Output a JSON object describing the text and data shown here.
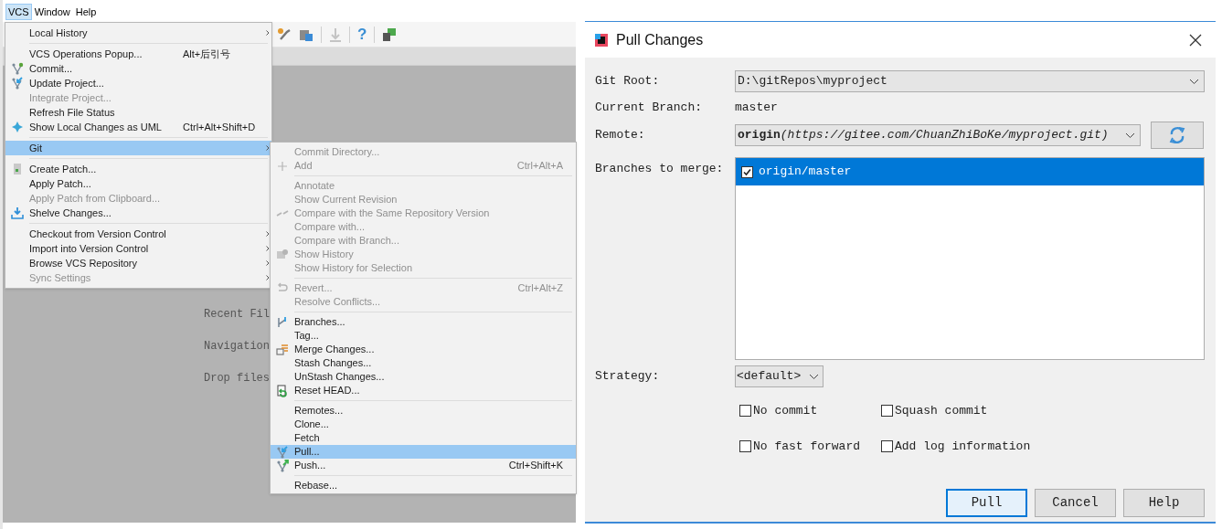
{
  "menu_bar": [
    {
      "label": "VCS",
      "selected": true
    },
    {
      "label": "Window",
      "selected": false
    },
    {
      "label": "Help",
      "selected": false
    }
  ],
  "toolbar": {
    "help_glyph": "?"
  },
  "welcome": [
    "Recent Fil",
    "Navigation",
    "Drop files"
  ],
  "vcs_menu": {
    "items": [
      {
        "kind": "item",
        "label": "Local History",
        "submenu": true,
        "disabled": false,
        "selected": false
      },
      {
        "kind": "separator"
      },
      {
        "kind": "item",
        "label": "VCS Operations Popup...",
        "shortcut": "Alt+后引号",
        "submenu": false,
        "disabled": false,
        "selected": false
      },
      {
        "kind": "item",
        "label": "Commit...",
        "submenu": false,
        "disabled": false,
        "selected": false
      },
      {
        "kind": "item",
        "label": "Update Project...",
        "submenu": false,
        "disabled": false,
        "selected": false
      },
      {
        "kind": "item",
        "label": "Integrate Project...",
        "submenu": false,
        "disabled": true,
        "selected": false
      },
      {
        "kind": "item",
        "label": "Refresh File Status",
        "submenu": false,
        "disabled": false,
        "selected": false
      },
      {
        "kind": "item",
        "label": "Show Local Changes as UML",
        "shortcut": "Ctrl+Alt+Shift+D",
        "submenu": false,
        "disabled": false,
        "selected": false
      },
      {
        "kind": "separator"
      },
      {
        "kind": "item",
        "label": "Git",
        "submenu": true,
        "disabled": false,
        "selected": true
      },
      {
        "kind": "separator"
      },
      {
        "kind": "item",
        "label": "Create Patch...",
        "submenu": false,
        "disabled": false,
        "selected": false
      },
      {
        "kind": "item",
        "label": "Apply Patch...",
        "submenu": false,
        "disabled": false,
        "selected": false
      },
      {
        "kind": "item",
        "label": "Apply Patch from Clipboard...",
        "submenu": false,
        "disabled": true,
        "selected": false
      },
      {
        "kind": "item",
        "label": "Shelve Changes...",
        "submenu": false,
        "disabled": false,
        "selected": false
      },
      {
        "kind": "separator"
      },
      {
        "kind": "item",
        "label": "Checkout from Version Control",
        "submenu": true,
        "disabled": false,
        "selected": false
      },
      {
        "kind": "item",
        "label": "Import into Version Control",
        "submenu": true,
        "disabled": false,
        "selected": false
      },
      {
        "kind": "item",
        "label": "Browse VCS Repository",
        "submenu": true,
        "disabled": false,
        "selected": false
      },
      {
        "kind": "item",
        "label": "Sync Settings",
        "submenu": true,
        "disabled": true,
        "selected": false
      }
    ]
  },
  "git_menu": {
    "items": [
      {
        "kind": "item",
        "label": "Commit Directory...",
        "disabled": true,
        "selected": false
      },
      {
        "kind": "item",
        "label": "Add",
        "shortcut": "Ctrl+Alt+A",
        "disabled": true,
        "selected": false
      },
      {
        "kind": "separator"
      },
      {
        "kind": "item",
        "label": "Annotate",
        "disabled": true,
        "selected": false
      },
      {
        "kind": "item",
        "label": "Show Current Revision",
        "disabled": true,
        "selected": false
      },
      {
        "kind": "item",
        "label": "Compare with the Same Repository Version",
        "disabled": true,
        "selected": false
      },
      {
        "kind": "item",
        "label": "Compare with...",
        "disabled": true,
        "selected": false
      },
      {
        "kind": "item",
        "label": "Compare with Branch...",
        "disabled": true,
        "selected": false
      },
      {
        "kind": "item",
        "label": "Show History",
        "disabled": true,
        "selected": false
      },
      {
        "kind": "item",
        "label": "Show History for Selection",
        "disabled": true,
        "selected": false
      },
      {
        "kind": "separator"
      },
      {
        "kind": "item",
        "label": "Revert...",
        "shortcut": "Ctrl+Alt+Z",
        "disabled": true,
        "selected": false
      },
      {
        "kind": "item",
        "label": "Resolve Conflicts...",
        "disabled": true,
        "selected": false
      },
      {
        "kind": "separator"
      },
      {
        "kind": "item",
        "label": "Branches...",
        "disabled": false,
        "selected": false
      },
      {
        "kind": "item",
        "label": "Tag...",
        "disabled": false,
        "selected": false
      },
      {
        "kind": "item",
        "label": "Merge Changes...",
        "disabled": false,
        "selected": false
      },
      {
        "kind": "item",
        "label": "Stash Changes...",
        "disabled": false,
        "selected": false
      },
      {
        "kind": "item",
        "label": "UnStash Changes...",
        "disabled": false,
        "selected": false
      },
      {
        "kind": "item",
        "label": "Reset HEAD...",
        "disabled": false,
        "selected": false
      },
      {
        "kind": "separator"
      },
      {
        "kind": "item",
        "label": "Remotes...",
        "disabled": false,
        "selected": false
      },
      {
        "kind": "item",
        "label": "Clone...",
        "disabled": false,
        "selected": false
      },
      {
        "kind": "item",
        "label": "Fetch",
        "disabled": false,
        "selected": false
      },
      {
        "kind": "item",
        "label": "Pull...",
        "disabled": false,
        "selected": true
      },
      {
        "kind": "item",
        "label": "Push...",
        "shortcut": "Ctrl+Shift+K",
        "disabled": false,
        "selected": false
      },
      {
        "kind": "separator"
      },
      {
        "kind": "item",
        "label": "Rebase...",
        "disabled": false,
        "selected": false
      }
    ]
  },
  "dialog": {
    "title": "Pull Changes",
    "git_root": {
      "label": "Git Root:",
      "value": "D:\\gitRepos\\myproject"
    },
    "current_branch": {
      "label": "Current Branch:",
      "value": "master"
    },
    "remote": {
      "label": "Remote:",
      "name": "origin",
      "url": "(https://gitee.com/ChuanZhiBoKe/myproject.git)"
    },
    "branches": {
      "label": "Branches to merge:",
      "items": [
        {
          "label": "origin/master",
          "checked": true,
          "selected": true
        }
      ]
    },
    "strategy": {
      "label": "Strategy:",
      "value": "<default>"
    },
    "options": [
      {
        "label": "No commit",
        "checked": false
      },
      {
        "label": "Squash commit",
        "checked": false
      },
      {
        "label": "No fast forward",
        "checked": false
      },
      {
        "label": "Add log information",
        "checked": false
      }
    ],
    "buttons": [
      {
        "label": "Pull",
        "default": true
      },
      {
        "label": "Cancel",
        "default": false
      },
      {
        "label": "Help",
        "default": false
      }
    ]
  }
}
